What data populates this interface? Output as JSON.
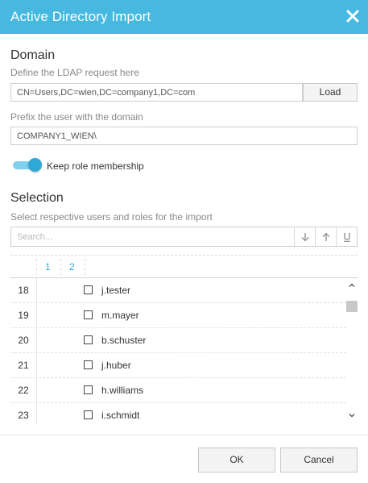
{
  "window": {
    "title": "Active Directory Import",
    "close_icon": "close-icon"
  },
  "domain": {
    "heading": "Domain",
    "ldap_label": "Define the LDAP request here",
    "ldap_value": "CN=Users,DC=wien,DC=company1,DC=com",
    "load_label": "Load",
    "prefix_label": "Prefix the user with the domain",
    "prefix_value": "COMPANY1_WIEN\\",
    "keep_roles_label": "Keep role membership",
    "keep_roles_on": true
  },
  "selection": {
    "heading": "Selection",
    "hint": "Select respective users and roles for the import",
    "search_placeholder": "Search...",
    "toolbar_icons": [
      "arrow-down-icon",
      "arrow-up-icon",
      "underline-icon"
    ],
    "columns": [
      "1",
      "2"
    ],
    "rows": [
      {
        "num": "18",
        "name": "j.tester"
      },
      {
        "num": "19",
        "name": "m.mayer"
      },
      {
        "num": "20",
        "name": "b.schuster"
      },
      {
        "num": "21",
        "name": "j.huber"
      },
      {
        "num": "22",
        "name": "h.williams"
      },
      {
        "num": "23",
        "name": "i.schmidt"
      }
    ]
  },
  "footer": {
    "ok_label": "OK",
    "cancel_label": "Cancel"
  },
  "colors": {
    "title_bar": "#47b8e0",
    "accent": "#2fa8d6",
    "toggle_track": "#7fd0ec"
  }
}
